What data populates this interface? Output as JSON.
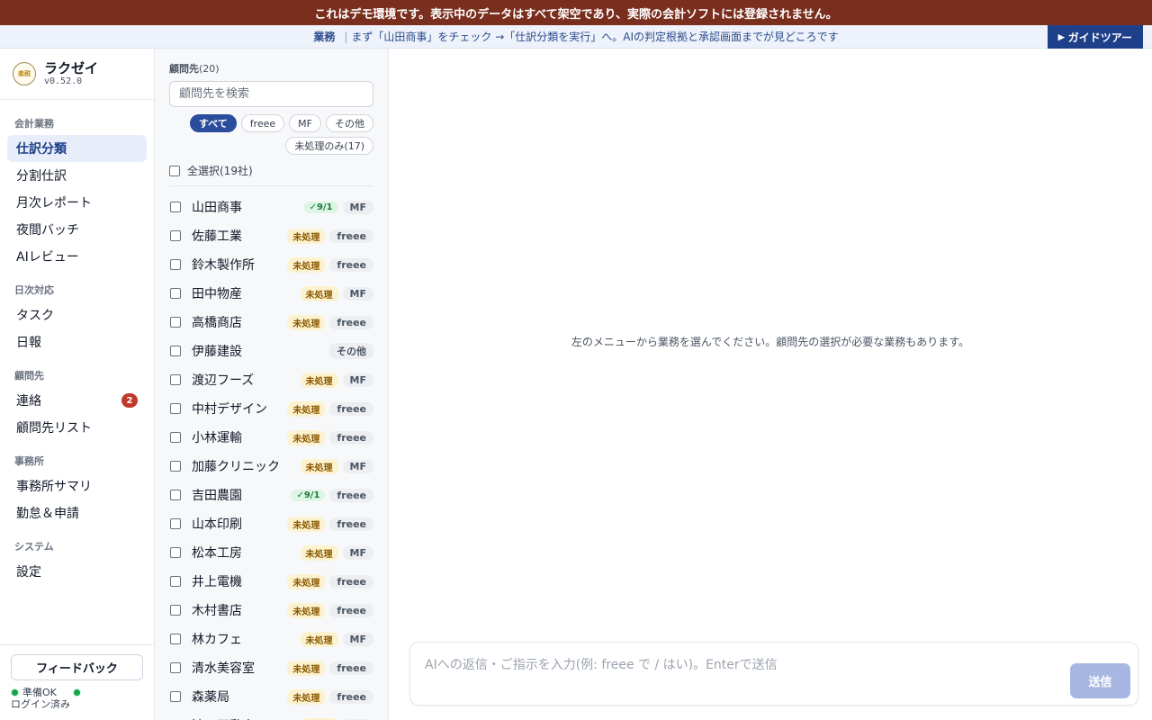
{
  "demo_banner": "これはデモ環境です。表示中のデータはすべて架空であり、実際の会計ソフトには登録されません。",
  "guide": {
    "category": "業務",
    "separator": "|",
    "text": "まず「山田商事」をチェック →「仕訳分類を実行」へ。AIの判定根拠と承認画面までが見どころです",
    "tour_button": "ガイドツアー"
  },
  "brand": {
    "name": "ラクゼイ",
    "version": "v0.52.0",
    "logo_text": "楽税"
  },
  "nav": {
    "sec_accounting": "会計業務",
    "shiwake": "仕訳分類",
    "bunkatsu": "分割仕訳",
    "getsuji": "月次レポート",
    "yakan": "夜間バッチ",
    "aireview": "AIレビュー",
    "sec_daily": "日次対応",
    "task": "タスク",
    "nippo": "日報",
    "sec_client": "顧問先",
    "renraku": "連絡",
    "renraku_badge": "2",
    "client_list": "顧問先リスト",
    "sec_office": "事務所",
    "office_summary": "事務所サマリ",
    "kintai": "勤怠＆申請",
    "sec_system": "システム",
    "settings": "設定"
  },
  "footer": {
    "feedback": "フィードバック",
    "ready": "準備OK",
    "login": "ログイン済み"
  },
  "clients": {
    "title": "顧問先",
    "count": "(20)",
    "search_placeholder": "顧問先を検索",
    "filters": {
      "all": "すべて",
      "freee": "freee",
      "mf": "MF",
      "other": "その他",
      "pending_only": "未処理のみ(17)"
    },
    "select_all": "全選択(19社)",
    "rows": [
      {
        "name": "山田商事",
        "status": "✓9/1",
        "status_type": "done",
        "software": "MF"
      },
      {
        "name": "佐藤工業",
        "status": "未処理",
        "status_type": "pending",
        "software": "freee"
      },
      {
        "name": "鈴木製作所",
        "status": "未処理",
        "status_type": "pending",
        "software": "freee"
      },
      {
        "name": "田中物産",
        "status": "未処理",
        "status_type": "pending",
        "software": "MF"
      },
      {
        "name": "高橋商店",
        "status": "未処理",
        "status_type": "pending",
        "software": "freee"
      },
      {
        "name": "伊藤建設",
        "status": "",
        "status_type": "none",
        "software": "その他"
      },
      {
        "name": "渡辺フーズ",
        "status": "未処理",
        "status_type": "pending",
        "software": "MF"
      },
      {
        "name": "中村デザイン",
        "status": "未処理",
        "status_type": "pending",
        "software": "freee"
      },
      {
        "name": "小林運輸",
        "status": "未処理",
        "status_type": "pending",
        "software": "freee"
      },
      {
        "name": "加藤クリニック",
        "status": "未処理",
        "status_type": "pending",
        "software": "MF"
      },
      {
        "name": "吉田農園",
        "status": "✓9/1",
        "status_type": "done",
        "software": "freee"
      },
      {
        "name": "山本印刷",
        "status": "未処理",
        "status_type": "pending",
        "software": "freee"
      },
      {
        "name": "松本工房",
        "status": "未処理",
        "status_type": "pending",
        "software": "MF"
      },
      {
        "name": "井上電機",
        "status": "未処理",
        "status_type": "pending",
        "software": "freee"
      },
      {
        "name": "木村書店",
        "status": "未処理",
        "status_type": "pending",
        "software": "freee"
      },
      {
        "name": "林カフェ",
        "status": "未処理",
        "status_type": "pending",
        "software": "MF"
      },
      {
        "name": "清水美容室",
        "status": "未処理",
        "status_type": "pending",
        "software": "freee"
      },
      {
        "name": "森薬局",
        "status": "未処理",
        "status_type": "pending",
        "software": "freee"
      },
      {
        "name": "池田不動産",
        "status": "未処理",
        "status_type": "pending",
        "software": "MF"
      }
    ]
  },
  "main": {
    "placeholder": "左のメニューから業務を選んでください。顧問先の選択が必要な業務もあります。",
    "composer_placeholder": "AIへの返信・ご指示を入力(例: freee で / はい)。Enterで送信",
    "send": "送信"
  }
}
